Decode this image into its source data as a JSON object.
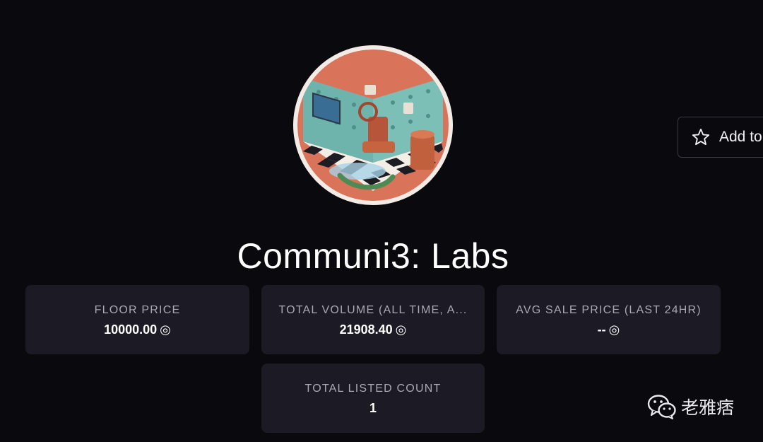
{
  "collection": {
    "title": "Communi3: Labs",
    "avatar_icon": "isometric-lab-room-avatar"
  },
  "watchlist": {
    "label": "Add to",
    "icon": "star-outline-icon"
  },
  "stats": {
    "floor": {
      "label": "FLOOR PRICE",
      "value": "10000.00",
      "unit": "◎"
    },
    "volume": {
      "label": "TOTAL VOLUME (ALL TIME, A...",
      "value": "21908.40",
      "unit": "◎"
    },
    "avg": {
      "label": "AVG SALE PRICE (LAST 24HR)",
      "value": "--",
      "unit": "◎"
    },
    "listed": {
      "label": "TOTAL LISTED COUNT",
      "value": "1"
    }
  },
  "watermark": {
    "text": "老雅痞",
    "icon": "wechat-icon"
  },
  "colors": {
    "background": "#0a090e",
    "card": "#1b1a25",
    "label": "#a9a8b3"
  }
}
